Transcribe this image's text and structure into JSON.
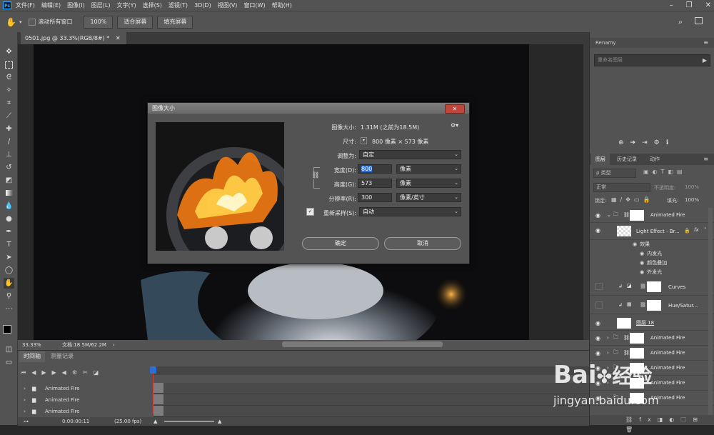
{
  "menubar": {
    "logo": "Ps",
    "items": [
      "文件(F)",
      "编辑(E)",
      "图像(I)",
      "图层(L)",
      "文字(Y)",
      "选择(S)",
      "滤镜(T)",
      "3D(D)",
      "视图(V)",
      "窗口(W)",
      "帮助(H)"
    ]
  },
  "options": {
    "scroll_all": "滚动所有窗口",
    "zoom": "100%",
    "fit_screen": "适合屏幕",
    "fill_screen": "填充屏幕"
  },
  "document": {
    "tab_title": "0501.jpg @ 33.3%(RGB/8#) *",
    "zoom": "33.33%",
    "doc_size": "文档:18.5M/62.2M"
  },
  "timeline": {
    "tabs": [
      "时间轴",
      "测量记录"
    ],
    "rows": [
      "Animated Fire",
      "Animated Fire",
      "Animated Fire"
    ],
    "time": "0:00:00:11",
    "fps": "(25.00 fps)"
  },
  "right_panel": {
    "renamy_title": "Renamy",
    "renamy_placeholder": "重命名图层",
    "tabs": [
      "图层",
      "历史记录",
      "动作"
    ],
    "filter_label": "ρ 类型",
    "blend_mode": "正常",
    "opacity_label": "不透明度:",
    "opacity_value": "100%",
    "lock_label": "锁定:",
    "fill_label": "填充:",
    "fill_value": "100%",
    "layers": [
      {
        "name": "Animated Fire"
      },
      {
        "name": "Light Effect - Br..."
      },
      {
        "name": "Curves"
      },
      {
        "name": "Hue/Satur..."
      },
      {
        "name": "图层 18"
      },
      {
        "name": "Animated Fire"
      },
      {
        "name": "Animated Fire"
      },
      {
        "name": "Animated Fire"
      },
      {
        "name": "Animated Fire"
      },
      {
        "name": "Animated Fire"
      }
    ],
    "effects_label": "效果",
    "effects": [
      "内发光",
      "颜色叠加",
      "外发光"
    ]
  },
  "dialog": {
    "title": "图像大小",
    "image_size_label": "图像大小:",
    "image_size_value": "1.31M (之前为18.5M)",
    "dimensions_label": "尺寸:",
    "dimensions_value": "800 像素 × 573 像素",
    "fit_label": "调整为:",
    "fit_value": "自定",
    "width_label": "宽度(D):",
    "width_value": "800",
    "width_unit": "像素",
    "height_label": "高度(G):",
    "height_value": "573",
    "height_unit": "像素",
    "resolution_label": "分辨率(R):",
    "resolution_value": "300",
    "resolution_unit": "像素/英寸",
    "resample_label": "重新采样(S):",
    "resample_value": "自动",
    "ok": "确定",
    "cancel": "取消"
  },
  "watermark": {
    "brand": "Bai",
    "brand2": "经验",
    "url": "jingyan.baidu.com"
  },
  "colors": {
    "accent": "#31a8ff",
    "selection": "#2b6fd6",
    "panel": "#535353"
  }
}
